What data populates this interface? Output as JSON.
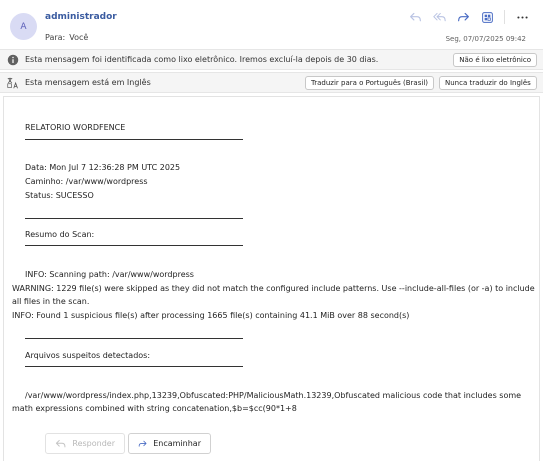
{
  "header": {
    "avatar_initial": "A",
    "sender": "administrador",
    "to_label": "Para:",
    "to_value": "Você",
    "date": "Seg, 07/07/2025 09:42"
  },
  "junk_banner": {
    "text": "Esta mensagem foi identificada como lixo eletrônico. Iremos excluí-la depois de 30 dias.",
    "button": "Não é lixo eletrônico"
  },
  "lang_banner": {
    "text": "Esta mensagem está em Inglês",
    "translate_button": "Traduzir para o Português (Brasil)",
    "never_button": "Nunca traduzir do Inglês"
  },
  "email": {
    "title": "RELATORIO WORDFENCE",
    "data_line": "Data: Mon Jul  7 12:36:28 PM UTC 2025",
    "path_line": "Caminho: /var/www/wordpress",
    "status_line": "Status: SUCESSO",
    "summary_heading": "Resumo do Scan:",
    "info_scanning": "INFO: Scanning path: /var/www/wordpress",
    "warning": "WARNING: 1229 file(s) were skipped as they did not match the configured include patterns. Use --include-all-files (or -a) to include all files in the scan.",
    "info_found": "INFO: Found 1 suspicious file(s) after processing 1665 file(s) containing 41.1 MiB over 88 second(s)",
    "suspicious_heading": "Arquivos suspeitos detectados:",
    "suspicious_entry": "/var/www/wordpress/index.php,13239,Obfuscated:PHP/MaliciousMath.13239,Obfuscated malicious code that includes some math expressions combined with string concatenation,$b=$cc(90*1+8"
  },
  "footer": {
    "reply": "Responder",
    "forward": "Encaminhar"
  },
  "colors": {
    "accent": "#3a5ba0",
    "avatar_bg": "#d9dbf4",
    "banner_bg": "#f5f5f5"
  }
}
